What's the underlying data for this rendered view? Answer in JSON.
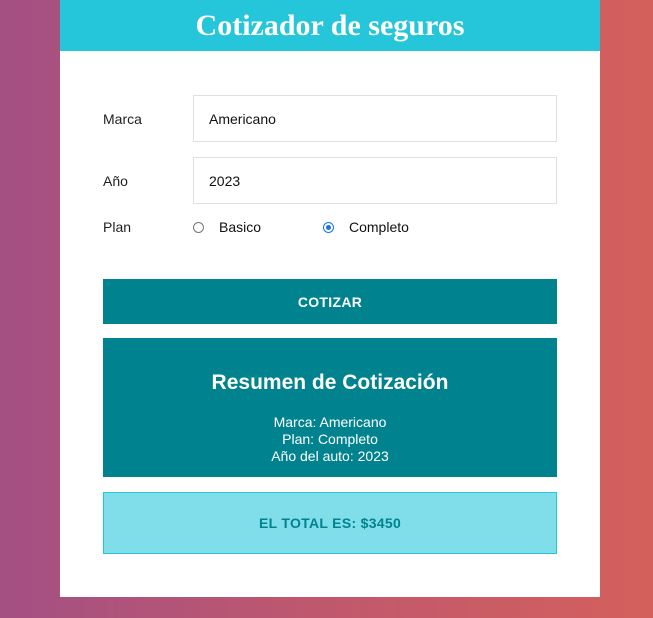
{
  "header": {
    "title": "Cotizador de seguros"
  },
  "form": {
    "marca": {
      "label": "Marca",
      "value": "Americano"
    },
    "anio": {
      "label": "Año",
      "value": "2023"
    },
    "plan": {
      "label": "Plan",
      "options": [
        {
          "label": "Basico",
          "checked": false
        },
        {
          "label": "Completo",
          "checked": true
        }
      ]
    },
    "submit_label": "COTIZAR"
  },
  "summary": {
    "title": "Resumen de Cotización",
    "marca_line": "Marca: Americano",
    "plan_line": "Plan: Completo",
    "anio_line": "Año del auto: 2023"
  },
  "total": {
    "text": "EL TOTAL ES: $3450"
  },
  "colors": {
    "header": "#26c6da",
    "primary": "#00838f",
    "total_bg": "#80deea",
    "radio_selected": "#1a73e8"
  }
}
